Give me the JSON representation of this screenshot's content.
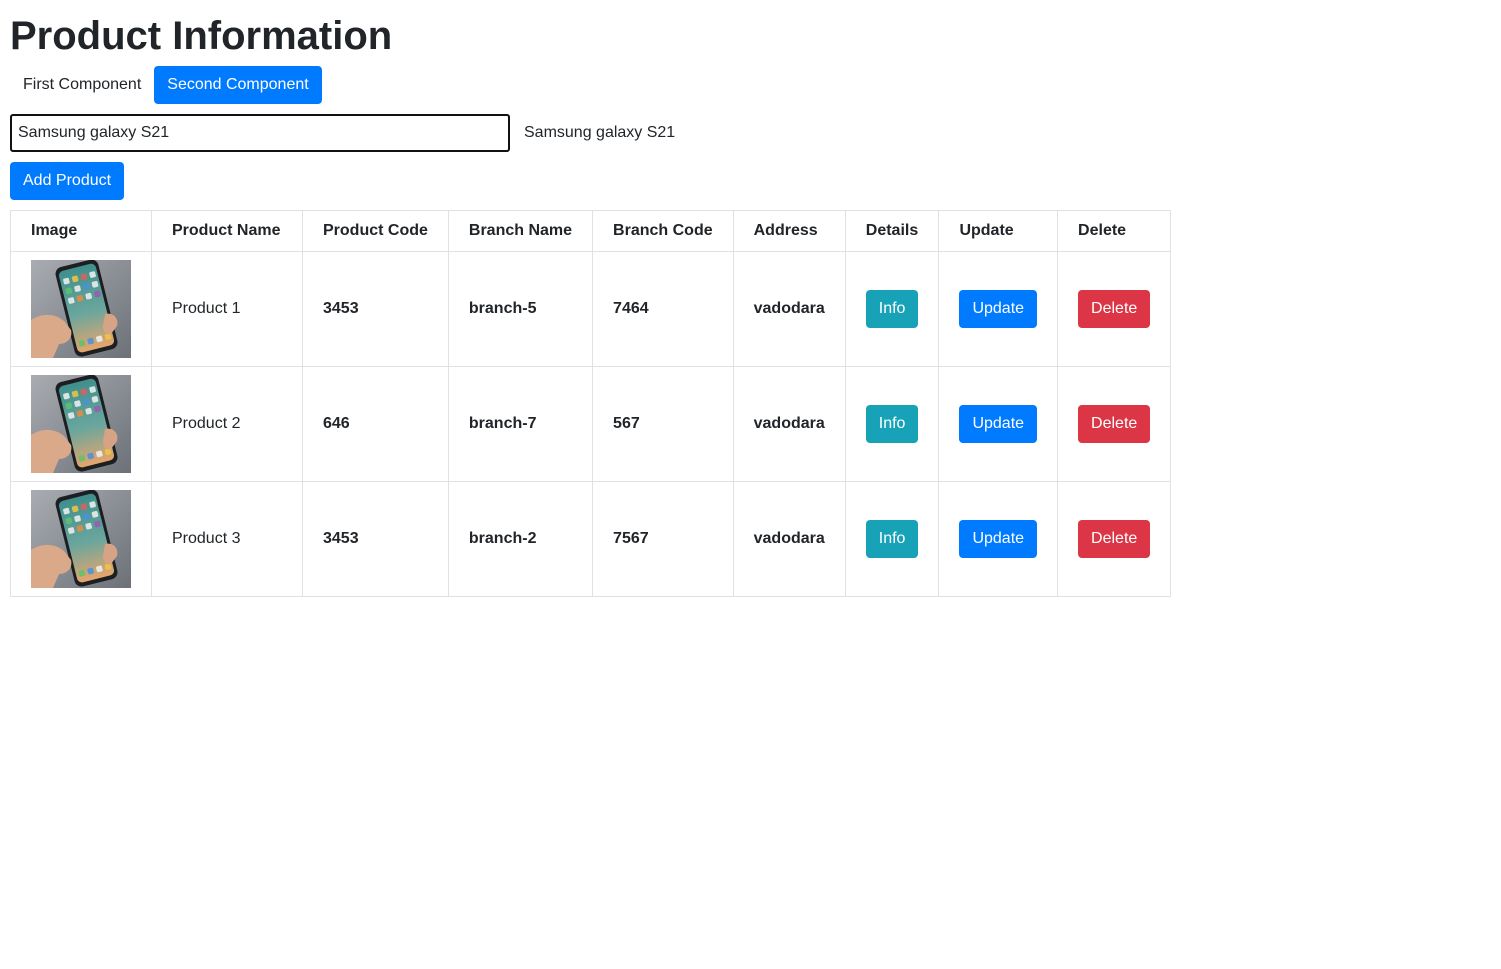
{
  "page": {
    "title": "Product Information"
  },
  "nav": {
    "tabs": [
      {
        "label": "First Component",
        "active": false
      },
      {
        "label": "Second Component",
        "active": true
      }
    ]
  },
  "search": {
    "value": "Samsung galaxy S21",
    "echo": "Samsung galaxy S21"
  },
  "actions": {
    "add_label": "Add Product"
  },
  "table": {
    "headers": [
      "Image",
      "Product Name",
      "Product Code",
      "Branch Name",
      "Branch Code",
      "Address",
      "Details",
      "Update",
      "Delete"
    ],
    "rows": [
      {
        "image": "phone-in-hand-photo",
        "name": "Product 1",
        "code": "3453",
        "branch": "branch-5",
        "branch_code": "7464",
        "address": "vadodara",
        "info": "Info",
        "update": "Update",
        "delete": "Delete"
      },
      {
        "image": "phone-in-hand-photo",
        "name": "Product 2",
        "code": "646",
        "branch": "branch-7",
        "branch_code": "567",
        "address": "vadodara",
        "info": "Info",
        "update": "Update",
        "delete": "Delete"
      },
      {
        "image": "phone-in-hand-photo",
        "name": "Product 3",
        "code": "3453",
        "branch": "branch-2",
        "branch_code": "7567",
        "address": "vadodara",
        "info": "Info",
        "update": "Update",
        "delete": "Delete"
      }
    ]
  },
  "colors": {
    "primary": "#007bff",
    "info": "#17a2b8",
    "danger": "#dc3545"
  }
}
